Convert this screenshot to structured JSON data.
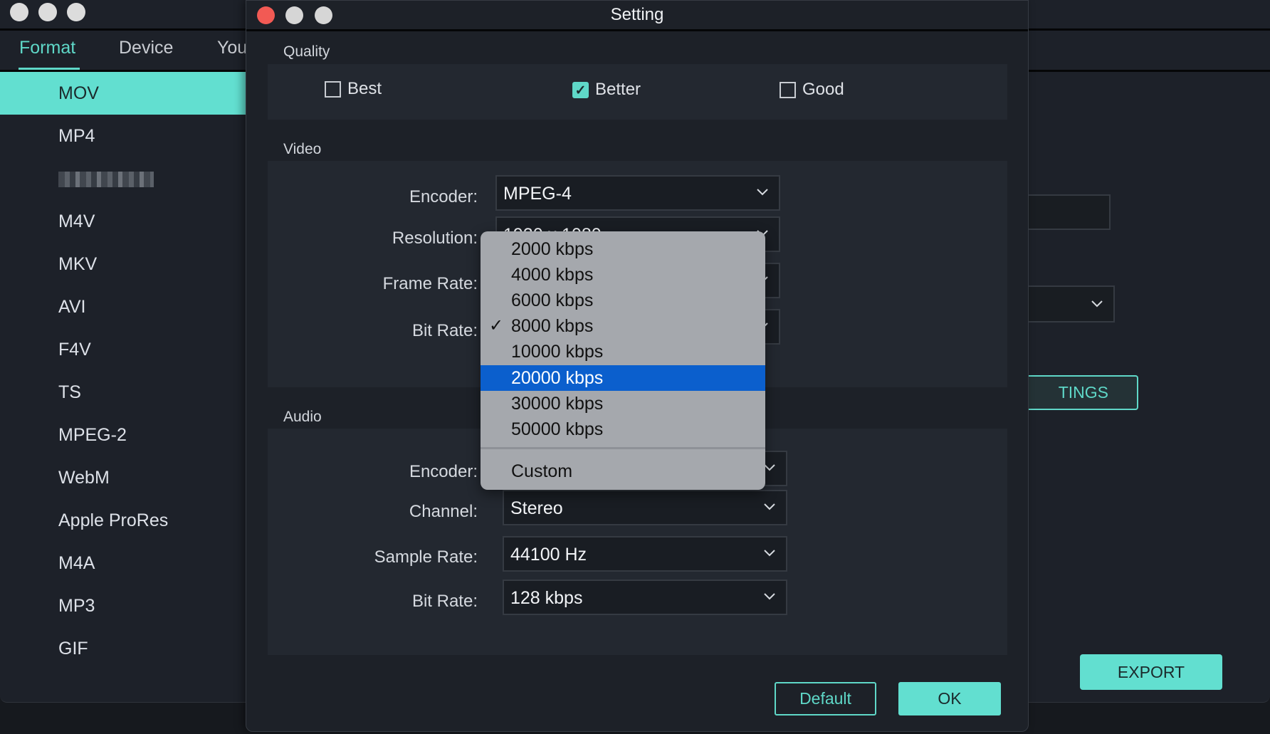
{
  "main_window": {
    "tabs": [
      {
        "label": "Format",
        "active": true
      },
      {
        "label": "Device",
        "active": false
      },
      {
        "label": "You",
        "active": false
      }
    ],
    "formats": [
      {
        "label": "MOV",
        "active": true
      },
      {
        "label": "MP4"
      },
      {
        "label": "",
        "redacted": true
      },
      {
        "label": "M4V"
      },
      {
        "label": "MKV"
      },
      {
        "label": "AVI"
      },
      {
        "label": "F4V"
      },
      {
        "label": "TS"
      },
      {
        "label": "MPEG-2"
      },
      {
        "label": "WebM"
      },
      {
        "label": "Apple ProRes"
      },
      {
        "label": "M4A"
      },
      {
        "label": "MP3"
      },
      {
        "label": "GIF"
      }
    ],
    "settings_button_partial": "TINGS",
    "export_label": "EXPORT"
  },
  "dialog": {
    "title": "Setting",
    "quality": {
      "label": "Quality",
      "options": [
        {
          "label": "Best",
          "checked": false
        },
        {
          "label": "Better",
          "checked": true
        },
        {
          "label": "Good",
          "checked": false
        }
      ]
    },
    "video": {
      "label": "Video",
      "encoder": {
        "label": "Encoder:",
        "value": "MPEG-4"
      },
      "resolution": {
        "label": "Resolution:",
        "value": "1920 x 1080"
      },
      "frame_rate": {
        "label": "Frame Rate:",
        "value": ""
      },
      "bit_rate": {
        "label": "Bit Rate:",
        "value": "8000 kbps"
      }
    },
    "audio": {
      "label": "Audio",
      "encoder": {
        "label": "Encoder:",
        "value": ""
      },
      "channel": {
        "label": "Channel:",
        "value": "Stereo"
      },
      "sample_rate": {
        "label": "Sample Rate:",
        "value": "44100 Hz"
      },
      "bit_rate": {
        "label": "Bit Rate:",
        "value": "128 kbps"
      }
    },
    "default_label": "Default",
    "ok_label": "OK"
  },
  "bitrate_menu": {
    "items": [
      "2000 kbps",
      "4000 kbps",
      "6000 kbps",
      "8000 kbps",
      "10000 kbps",
      "20000 kbps",
      "30000 kbps",
      "50000 kbps"
    ],
    "checked": "8000 kbps",
    "highlighted": "20000 kbps",
    "custom_label": "Custom",
    "check_glyph": "✓"
  },
  "colors": {
    "accent": "#62dfd0",
    "highlight": "#0b5fcd",
    "close_button": "#f25a54"
  }
}
